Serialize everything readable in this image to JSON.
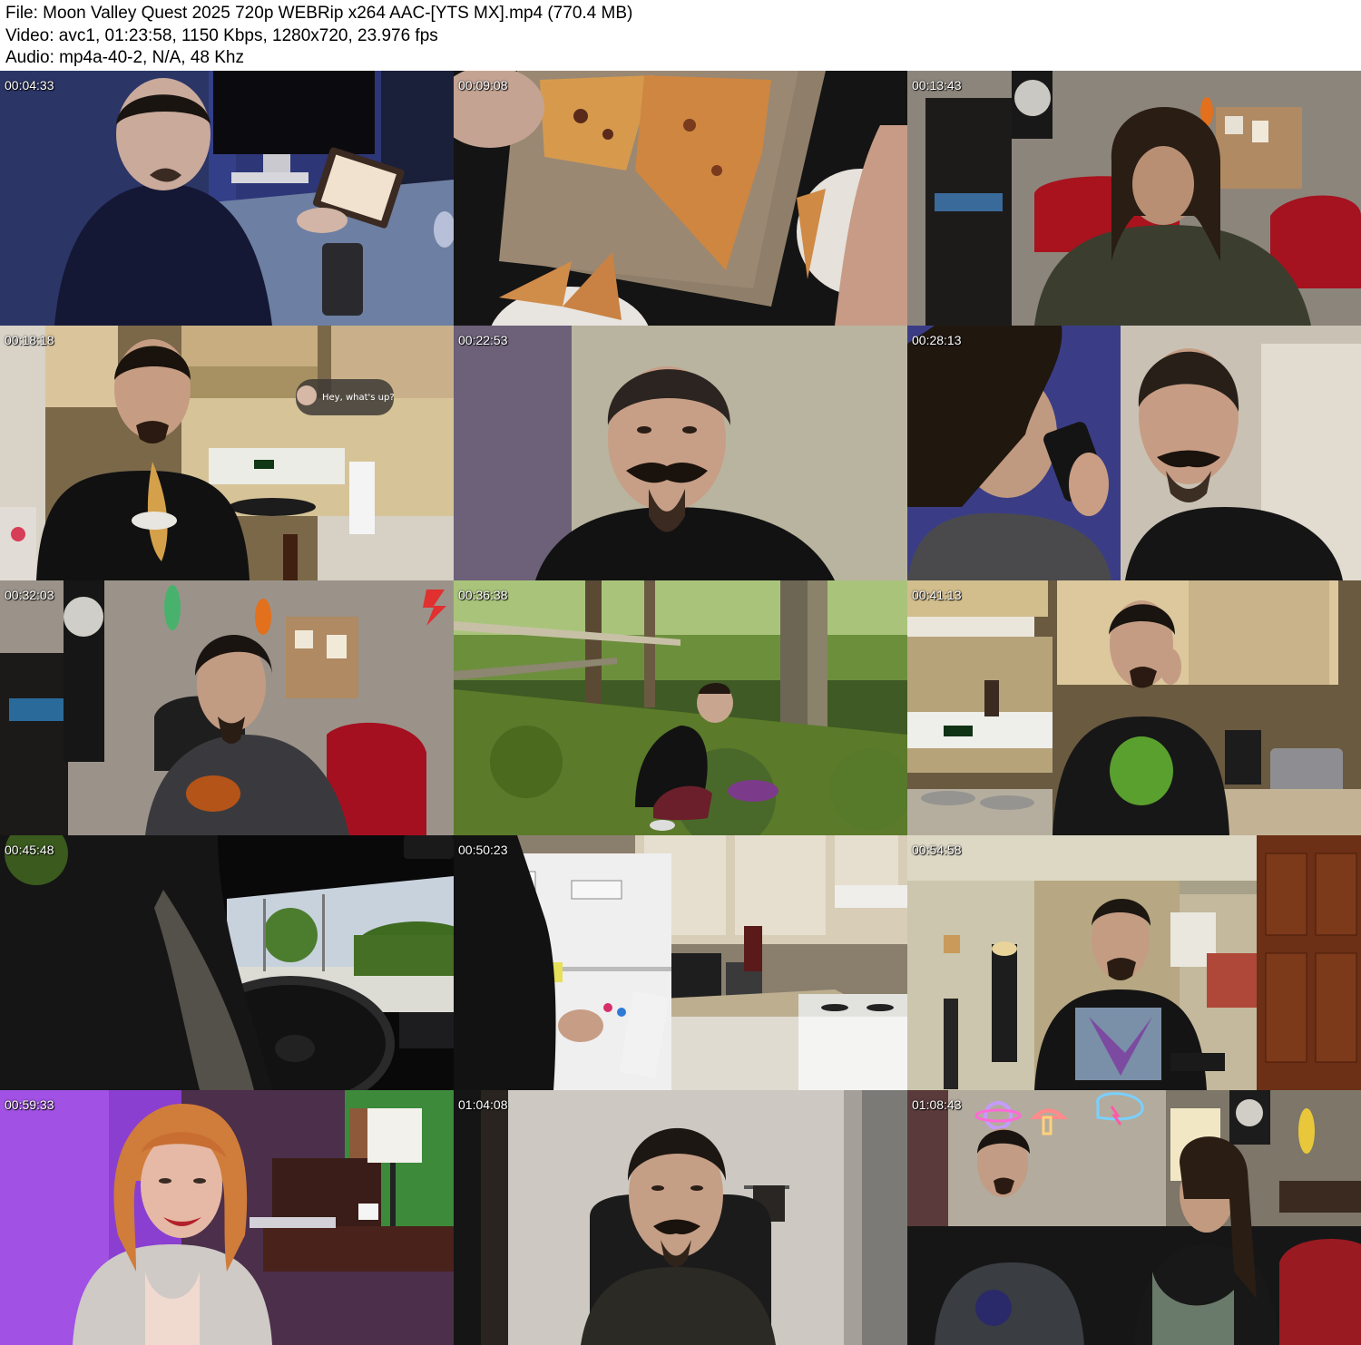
{
  "header": {
    "file_line": "File: Moon Valley Quest 2025 720p WEBRip x264 AAC-[YTS MX].mp4 (770.4 MB)",
    "video_line": "Video: avc1, 01:23:58, 1150 Kbps, 1280x720, 23.976 fps",
    "audio_line": "Audio: mp4a-40-2, N/A, 48 Khz"
  },
  "thumbnails": [
    {
      "timestamp": "00:04:33",
      "scene": "man-at-desk-with-tablet"
    },
    {
      "timestamp": "00:09:08",
      "scene": "pizza-box-overhead"
    },
    {
      "timestamp": "00:13:43",
      "scene": "long-haired-man-red-chair"
    },
    {
      "timestamp": "00:18:18",
      "scene": "man-in-kitchen-chat-bubble",
      "overlay_text": "Hey, what's up?"
    },
    {
      "timestamp": "00:22:53",
      "scene": "man-smiling-closeup"
    },
    {
      "timestamp": "00:28:13",
      "scene": "two-men-phone-call"
    },
    {
      "timestamp": "00:32:03",
      "scene": "long-haired-man-room-with-belt"
    },
    {
      "timestamp": "00:36:38",
      "scene": "man-crouching-in-forest"
    },
    {
      "timestamp": "00:41:13",
      "scene": "man-on-phone-in-kitchen"
    },
    {
      "timestamp": "00:45:48",
      "scene": "driving-car-interior"
    },
    {
      "timestamp": "00:50:23",
      "scene": "man-at-fridge-kitchen"
    },
    {
      "timestamp": "00:54:58",
      "scene": "man-standing-living-room"
    },
    {
      "timestamp": "00:59:33",
      "scene": "woman-smiling-purple-light"
    },
    {
      "timestamp": "01:04:08",
      "scene": "man-seated-dim-room"
    },
    {
      "timestamp": "01:08:43",
      "scene": "two-men-on-couch-neon-signs"
    }
  ]
}
